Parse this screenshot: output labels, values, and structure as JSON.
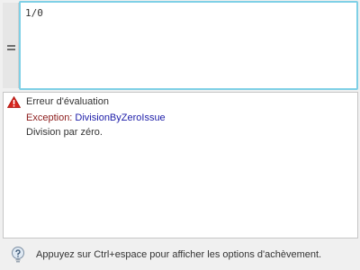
{
  "expression": {
    "gutter_icon": "equals-icon",
    "text": "1/0"
  },
  "result": {
    "status_icon": "error-triangle-icon",
    "title": "Erreur d'évaluation",
    "exception_label": "Exception: ",
    "exception_name": "DivisionByZeroIssue",
    "message": "Division par zéro."
  },
  "status_bar": {
    "icon": "info-bulb-icon",
    "hint": "Appuyez sur Ctrl+espace pour afficher les options d'achèvement."
  },
  "colors": {
    "editor_border": "#7fd0e6",
    "error_red": "#d7261e",
    "exception_label": "#8b1a1a",
    "exception_name": "#1c1ca8"
  }
}
